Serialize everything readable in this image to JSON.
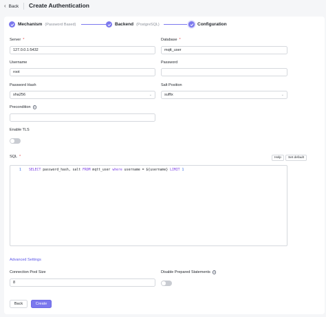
{
  "topbar": {
    "back_label": "Back",
    "title": "Create Authentication"
  },
  "steps": [
    {
      "title": "Mechanism",
      "sub": "(Password Based)"
    },
    {
      "title": "Backend",
      "sub": "(PostgreSQL)"
    },
    {
      "title": "Configuration",
      "sub": ""
    }
  ],
  "form": {
    "server": {
      "label": "Server",
      "value": "127.0.0.1:5432"
    },
    "database": {
      "label": "Database",
      "value": "mqtt_user"
    },
    "username": {
      "label": "Username",
      "value": "root"
    },
    "password": {
      "label": "Password",
      "value": ""
    },
    "password_hash": {
      "label": "Password Hash",
      "value": "sha256"
    },
    "salt_position": {
      "label": "Salt Position",
      "value": "suffix"
    },
    "precondition": {
      "label": "Precondition",
      "value": ""
    },
    "enable_tls": {
      "label": "Enable TLS",
      "on": false
    },
    "sql": {
      "label": "SQL",
      "help_label": "Help",
      "set_default_label": "Set default",
      "line_number": "1",
      "code_select": "SELECT",
      "code_cols": " password_hash, salt ",
      "code_from": "FROM",
      "code_table": " mqtt_user ",
      "code_where": "where",
      "code_cond": " username = ${username} ",
      "code_limit": "LIMIT",
      "code_num": "1"
    },
    "advanced_settings_label": "Advanced Settings",
    "pool_size": {
      "label": "Connection Pool Size",
      "value": "8"
    },
    "disable_prepared": {
      "label": "Disable Prepared Statements",
      "on": false
    }
  },
  "actions": {
    "back_label": "Back",
    "create_label": "Create"
  },
  "colors": {
    "accent": "#7b78ee",
    "link": "#5a55e8",
    "required": "#e5484d"
  },
  "icons": {
    "back": "chevron-left-icon",
    "step_done": "check-icon",
    "info": "info-circle-icon",
    "select": "chevron-down-icon"
  }
}
